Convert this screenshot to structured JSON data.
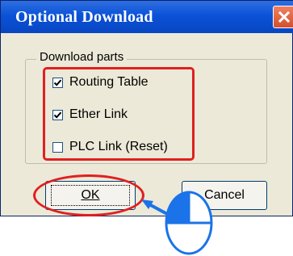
{
  "window": {
    "title": "Optional Download",
    "close_icon": "close-icon"
  },
  "group": {
    "label": "Download parts",
    "items": [
      {
        "label": "Routing Table",
        "checked": true
      },
      {
        "label": "Ether Link",
        "checked": true
      },
      {
        "label": "PLC Link (Reset)",
        "checked": false
      }
    ]
  },
  "buttons": {
    "ok": "OK",
    "cancel": "Cancel"
  },
  "annotation": {
    "color": "#e02020",
    "pointer_color": "#1a73e8"
  }
}
